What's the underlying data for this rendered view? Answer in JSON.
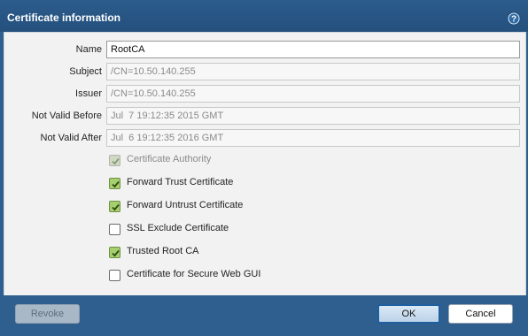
{
  "dialog": {
    "title": "Certificate information",
    "help_icon": "help-icon"
  },
  "fields": {
    "name": {
      "label": "Name",
      "value": "RootCA"
    },
    "subject": {
      "label": "Subject",
      "value": "/CN=10.50.140.255"
    },
    "issuer": {
      "label": "Issuer",
      "value": "/CN=10.50.140.255"
    },
    "not_valid_before": {
      "label": "Not Valid Before",
      "value": "Jul  7 19:12:35 2015 GMT"
    },
    "not_valid_after": {
      "label": "Not Valid After",
      "value": "Jul  6 19:12:35 2016 GMT"
    }
  },
  "checkboxes": [
    {
      "label": "Certificate Authority",
      "checked": true,
      "disabled": true
    },
    {
      "label": "Forward Trust Certificate",
      "checked": true,
      "disabled": false
    },
    {
      "label": "Forward Untrust Certificate",
      "checked": true,
      "disabled": false
    },
    {
      "label": "SSL Exclude Certificate",
      "checked": false,
      "disabled": false
    },
    {
      "label": "Trusted Root CA",
      "checked": true,
      "disabled": false
    },
    {
      "label": "Certificate for Secure Web GUI",
      "checked": false,
      "disabled": false
    }
  ],
  "buttons": {
    "revoke": "Revoke",
    "ok": "OK",
    "cancel": "Cancel"
  }
}
